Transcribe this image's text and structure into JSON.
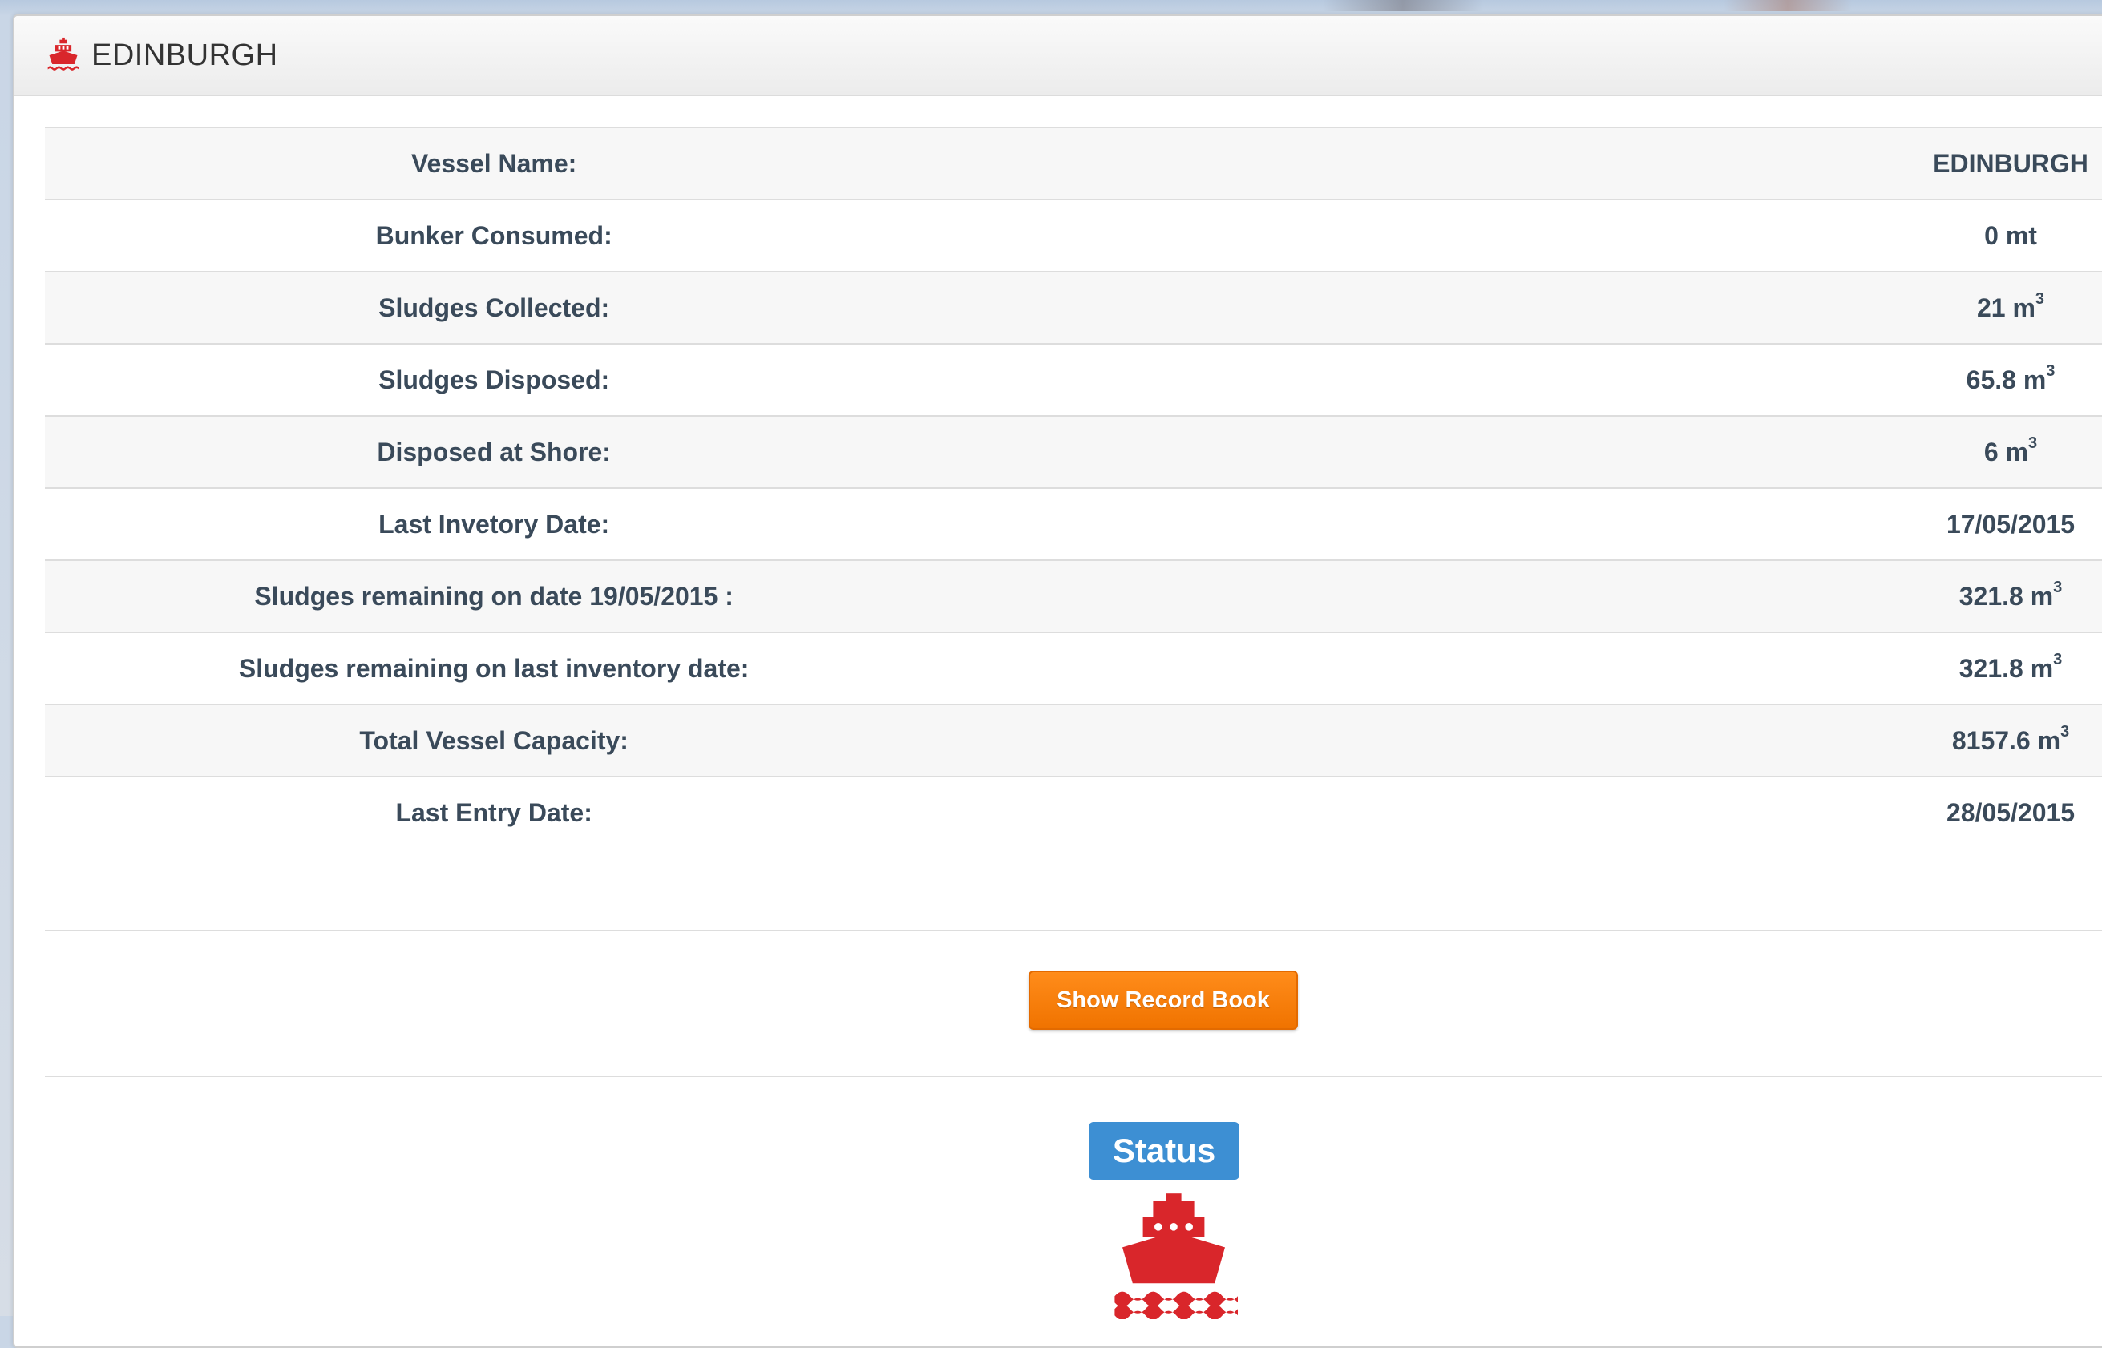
{
  "panel": {
    "title": "EDINBURGH",
    "icon": "ship-icon",
    "icon_color": "#d9262b"
  },
  "details": [
    {
      "label": "Vessel Name:",
      "value": "EDINBURGH",
      "unit_sup": ""
    },
    {
      "label": "Bunker Consumed:",
      "value": "0 mt",
      "unit_sup": ""
    },
    {
      "label": "Sludges Collected:",
      "value": "21 m",
      "unit_sup": "3"
    },
    {
      "label": "Sludges Disposed:",
      "value": "65.8 m",
      "unit_sup": "3"
    },
    {
      "label": "Disposed at Shore:",
      "value": "6 m",
      "unit_sup": "3"
    },
    {
      "label": "Last Invetory Date:",
      "value": "17/05/2015",
      "unit_sup": ""
    },
    {
      "label": "Sludges remaining on date 19/05/2015 :",
      "value": "321.8 m",
      "unit_sup": "3"
    },
    {
      "label": "Sludges remaining on last inventory date:",
      "value": "321.8 m",
      "unit_sup": "3"
    },
    {
      "label": "Total Vessel Capacity:",
      "value": "8157.6 m",
      "unit_sup": "3"
    },
    {
      "label": "Last Entry Date:",
      "value": "28/05/2015",
      "unit_sup": ""
    }
  ],
  "actions": {
    "record_book_label": "Show Record Book",
    "record_book_color": "#f58220"
  },
  "status": {
    "label": "Status",
    "badge_color": "#3d8fd3",
    "icon": "ship-icon",
    "icon_color": "#d9262b"
  }
}
